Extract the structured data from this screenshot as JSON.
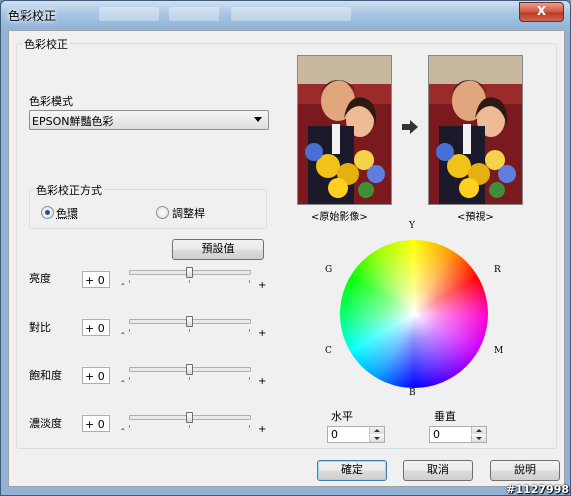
{
  "window": {
    "title": "色彩校正",
    "close_label": "X"
  },
  "group_main": {
    "title": "色彩校正"
  },
  "color_mode": {
    "label": "色彩模式",
    "selected": "EPSON鮮豔色彩"
  },
  "method": {
    "title": "色彩校正方式",
    "options": [
      {
        "label": "色環",
        "selected": true
      },
      {
        "label": "調整桿",
        "selected": false
      }
    ]
  },
  "preset_button": "預設值",
  "sliders": [
    {
      "label": "亮度",
      "value": "+ 0",
      "minus": "-",
      "plus": "+",
      "level": 0.5
    },
    {
      "label": "對比",
      "value": "+ 0",
      "minus": "-",
      "plus": "+",
      "level": 0.5
    },
    {
      "label": "飽和度",
      "value": "+ 0",
      "minus": "-",
      "plus": "+",
      "level": 0.5
    },
    {
      "label": "濃淡度",
      "value": "+ 0",
      "minus": "-",
      "plus": "+",
      "level": 0.5
    }
  ],
  "preview": {
    "original_caption": "<原始影像>",
    "preview_caption": "<預視>",
    "arrow_icon": "right-arrow-icon"
  },
  "wheel": {
    "labels": {
      "Y": "Y",
      "R": "R",
      "M": "M",
      "B": "B",
      "C": "C",
      "G": "G"
    },
    "center": "+"
  },
  "horizontal": {
    "label": "水平",
    "value": "0"
  },
  "vertical": {
    "label": "垂直",
    "value": "0"
  },
  "buttons": {
    "ok": "確定",
    "cancel": "取消",
    "help": "說明"
  },
  "watermark": "#1127998"
}
